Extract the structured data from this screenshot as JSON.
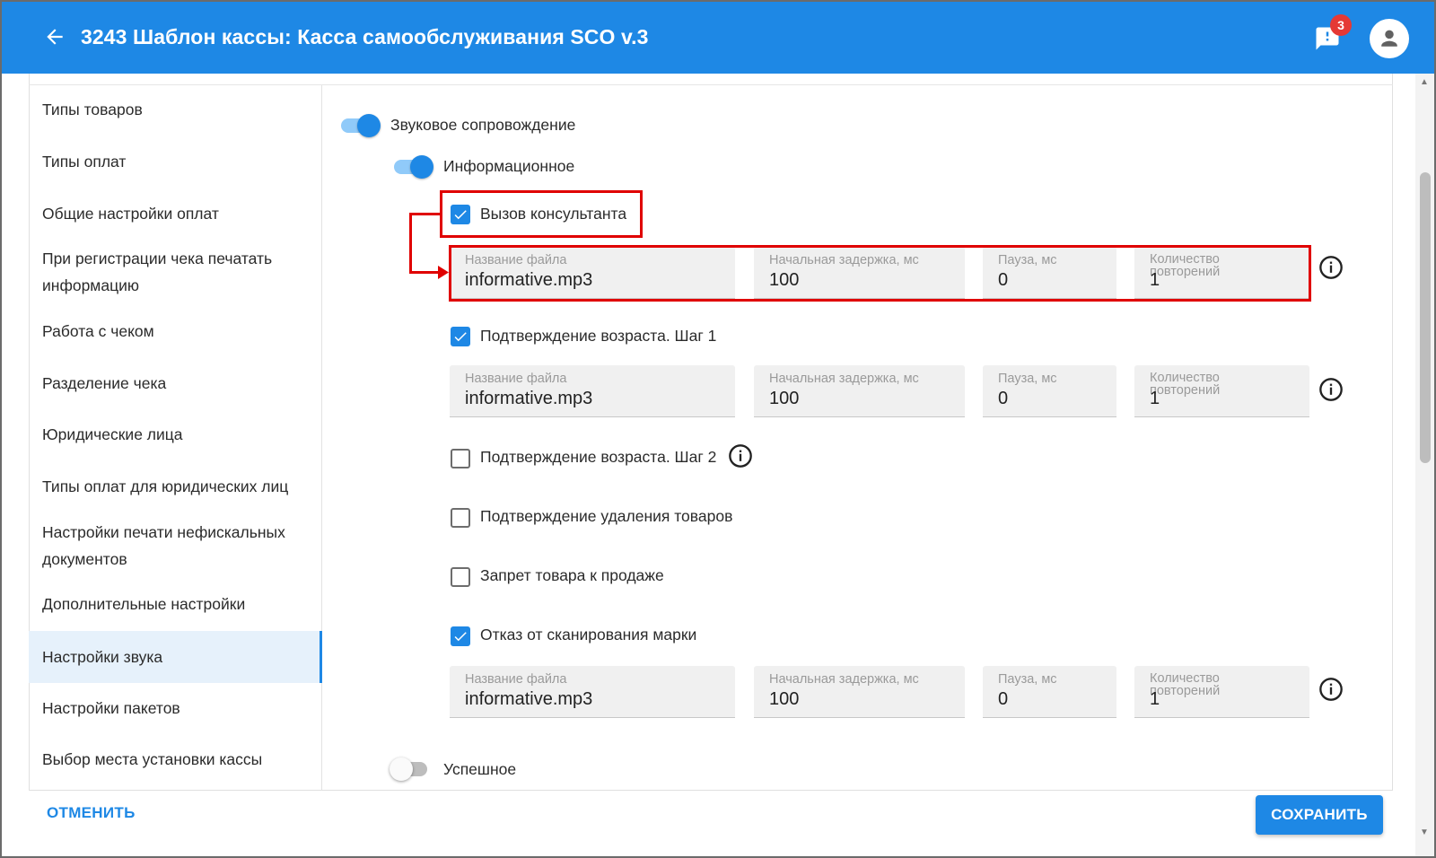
{
  "header": {
    "title": "3243 Шаблон кассы: Касса самообслуживания SCO v.3",
    "notifications_count": "3"
  },
  "sidebar": {
    "items": [
      {
        "label": "Типы товаров"
      },
      {
        "label": "Типы оплат"
      },
      {
        "label": "Общие настройки оплат"
      },
      {
        "label": "При регистрации чека печатать информацию"
      },
      {
        "label": "Работа с чеком"
      },
      {
        "label": "Разделение чека"
      },
      {
        "label": "Юридические лица"
      },
      {
        "label": "Типы оплат для юридических лиц"
      },
      {
        "label": "Настройки печати нефискальных документов"
      },
      {
        "label": "Дополнительные настройки"
      },
      {
        "label": "Настройки звука",
        "active": true
      },
      {
        "label": "Настройки пакетов"
      },
      {
        "label": "Выбор места установки кассы"
      }
    ]
  },
  "content": {
    "sound_toggle": {
      "label": "Звуковое сопровождение",
      "on": true
    },
    "info_toggle": {
      "label": "Информационное",
      "on": true
    },
    "success_toggle": {
      "label": "Успешное",
      "on": false
    },
    "field_labels": {
      "file": "Название файла",
      "delay": "Начальная задержка, мс",
      "pause": "Пауза, мс",
      "repeats": "Количество повторений"
    },
    "options": [
      {
        "label": "Вызов консультанта",
        "checked": true,
        "file": "informative.mp3",
        "delay": "100",
        "pause": "0",
        "repeats": "1"
      },
      {
        "label": "Подтверждение возраста. Шаг 1",
        "checked": true,
        "file": "informative.mp3",
        "delay": "100",
        "pause": "0",
        "repeats": "1"
      },
      {
        "label": "Подтверждение возраста. Шаг 2",
        "checked": false
      },
      {
        "label": "Подтверждение удаления товаров",
        "checked": false
      },
      {
        "label": "Запрет товара к продаже",
        "checked": false
      },
      {
        "label": "Отказ от сканирования марки",
        "checked": true,
        "file": "informative.mp3",
        "delay": "100",
        "pause": "0",
        "repeats": "1"
      }
    ]
  },
  "footer": {
    "cancel_label": "ОТМЕНИТЬ",
    "save_label": "СОХРАНИТЬ"
  },
  "colors": {
    "primary": "#1e88e5",
    "annotation": "#e00000",
    "badge": "#e53935"
  },
  "icons": [
    "back-arrow-icon",
    "chat-alert-icon",
    "account-icon",
    "check-icon",
    "info-icon"
  ]
}
